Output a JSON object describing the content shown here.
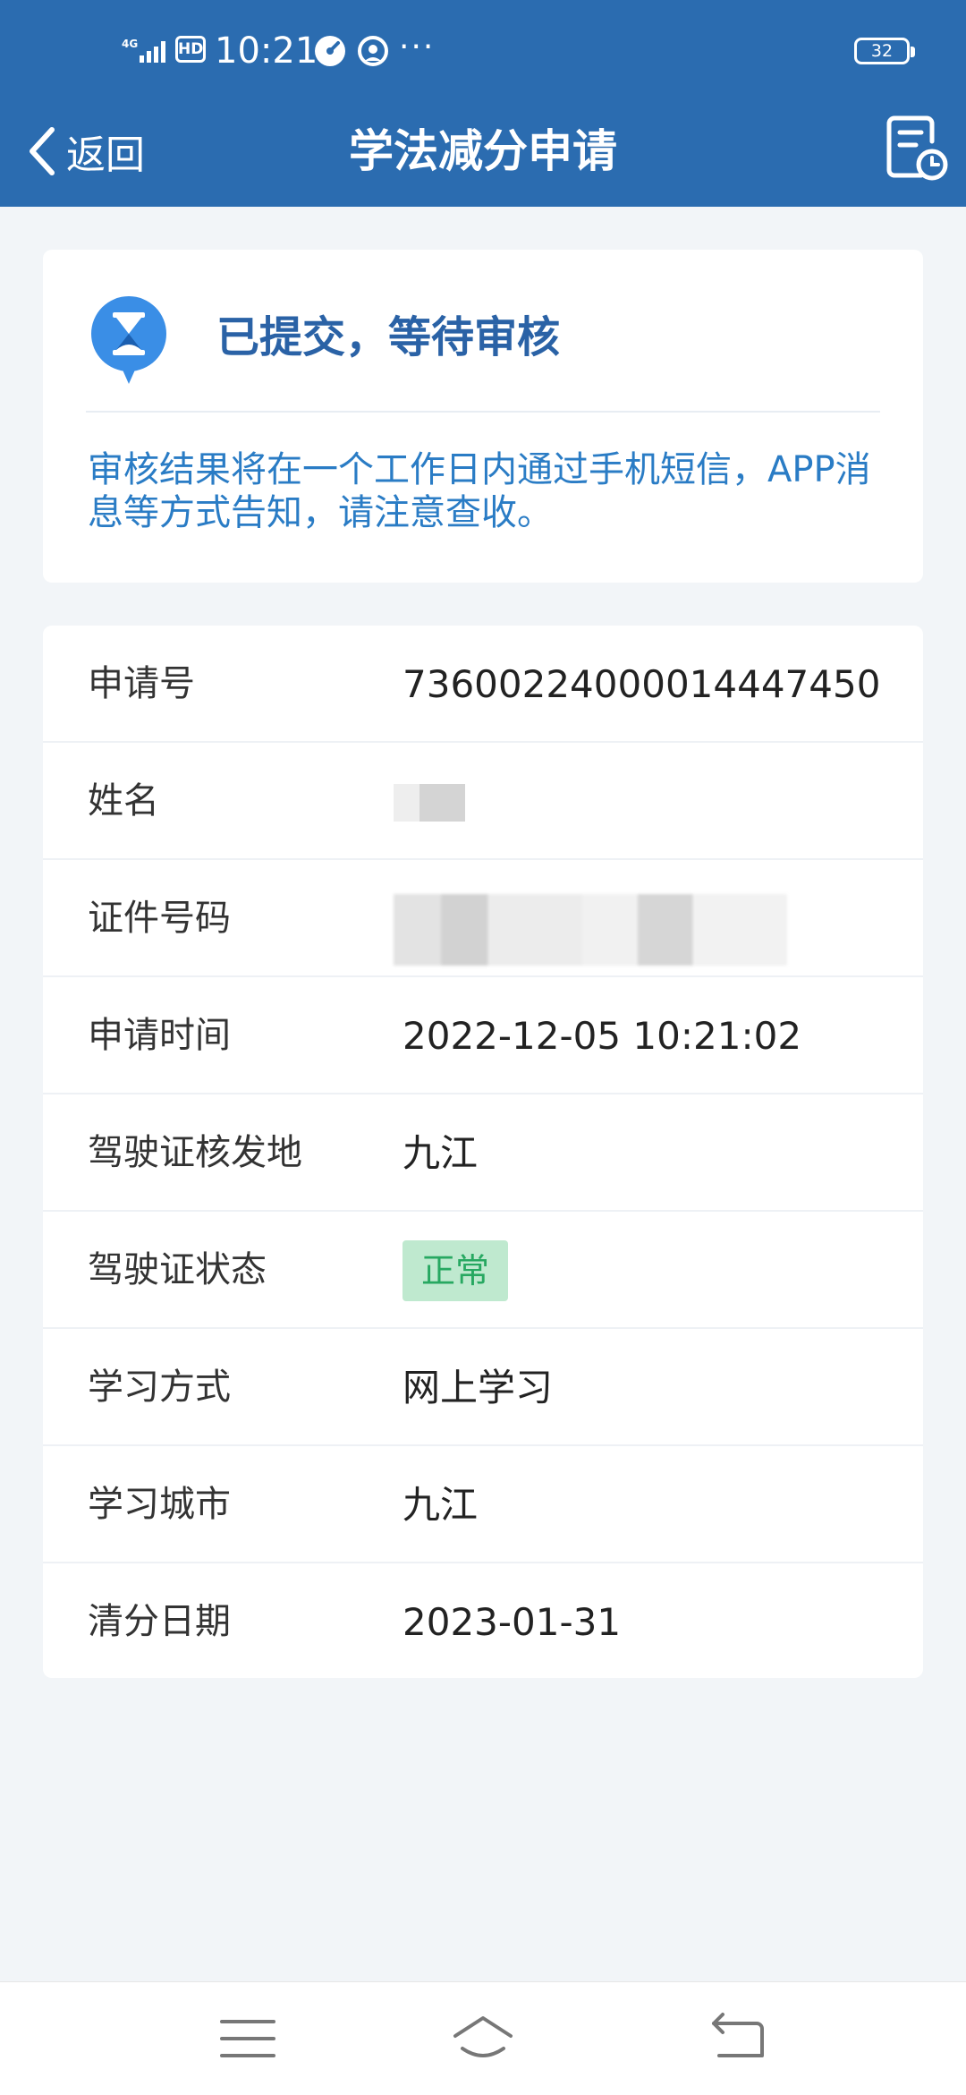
{
  "status_bar": {
    "network": "4G",
    "hd": "HD",
    "time": "10:21",
    "more": "···",
    "battery": "32",
    "icons": [
      "signal-icon",
      "hd-icon",
      "speedometer-icon",
      "chat-bubble-icon",
      "battery-icon"
    ]
  },
  "nav": {
    "back_label": "返回",
    "title": "学法减分申请",
    "icons": [
      "back-chevron-icon",
      "history-record-icon"
    ]
  },
  "status_card": {
    "icon": "hourglass-icon",
    "title": "已提交，等待审核",
    "description": "审核结果将在一个工作日内通过手机短信，APP消息等方式告知，请注意查收。",
    "colors": {
      "title": "#2a62a6",
      "description": "#2a7cc5",
      "icon": "#3a8ee6"
    }
  },
  "info_rows": [
    {
      "label": "申请号",
      "value": "73600224000014447450"
    },
    {
      "label": "姓名",
      "value": ""
    },
    {
      "label": "证件号码",
      "value": ""
    },
    {
      "label": "申请时间",
      "value": "2022-12-05 10:21:02"
    },
    {
      "label": "驾驶证核发地",
      "value": "九江"
    },
    {
      "label": "驾驶证状态",
      "value": "正常"
    },
    {
      "label": "学习方式",
      "value": "网上学习"
    },
    {
      "label": "学习城市",
      "value": "九江"
    },
    {
      "label": "清分日期",
      "value": "2023-01-31"
    }
  ],
  "theme": {
    "header_bg": "#2b6cb0",
    "page_bg": "#f2f5f8",
    "badge_bg": "#bfe9cf",
    "badge_text": "#27a861"
  },
  "system_nav": {
    "icons": [
      "menu-icon",
      "home-icon",
      "return-icon"
    ]
  }
}
